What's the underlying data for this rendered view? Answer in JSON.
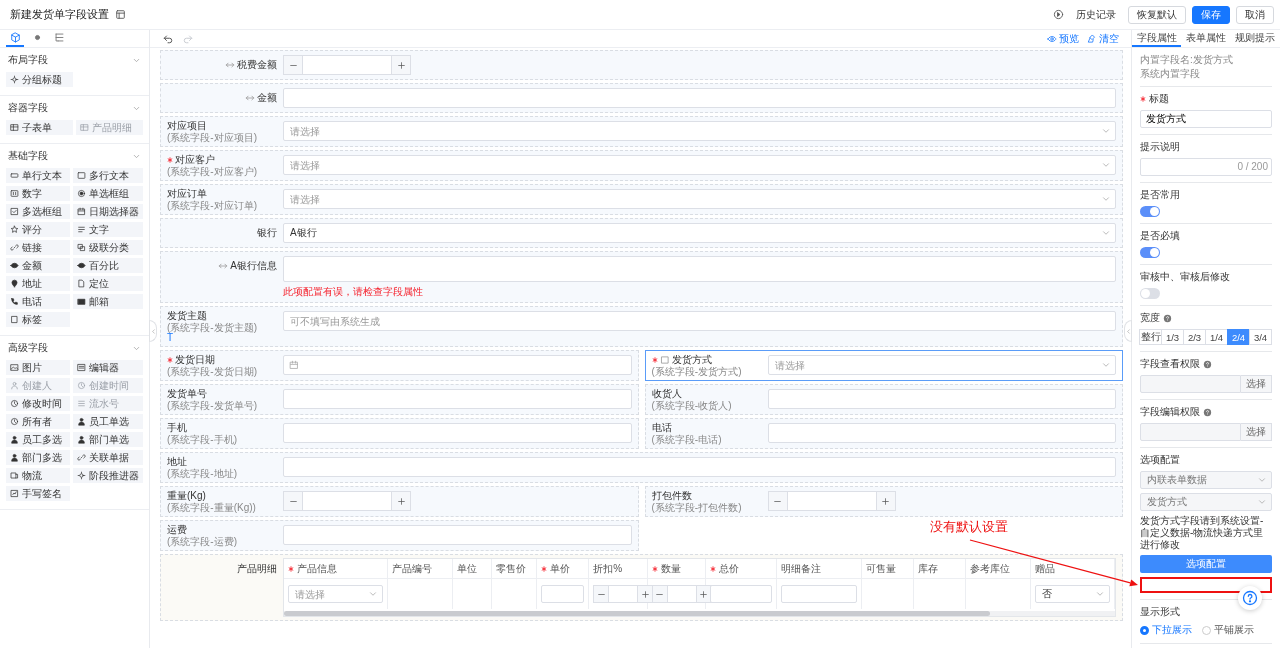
{
  "window": {
    "title": "新建发货单字段设置"
  },
  "header": {
    "history": "历史记录",
    "buttons": [
      {
        "label": "恢复默认",
        "kind": "default"
      },
      {
        "label": "保存",
        "kind": "primary"
      },
      {
        "label": "取消",
        "kind": "default"
      }
    ]
  },
  "sidebar": {
    "tabs": [
      {
        "kind": "components",
        "selected": true
      },
      {
        "kind": "settings",
        "selected": false
      },
      {
        "kind": "outline",
        "selected": false
      }
    ],
    "groups": [
      {
        "title": "布局字段",
        "expanded": true,
        "items": [
          {
            "label": "分组标题",
            "kind": "group-title",
            "disabled": false
          }
        ]
      },
      {
        "title": "容器字段",
        "expanded": true,
        "items": [
          {
            "label": "子表单",
            "kind": "subform",
            "disabled": false
          },
          {
            "label": "产品明细",
            "kind": "product",
            "disabled": true
          }
        ]
      },
      {
        "title": "基础字段",
        "expanded": true,
        "items": [
          {
            "label": "单行文本",
            "kind": "text-line",
            "disabled": false
          },
          {
            "label": "多行文本",
            "kind": "text-area",
            "disabled": false
          },
          {
            "label": "数字",
            "kind": "number",
            "disabled": false
          },
          {
            "label": "单选框组",
            "kind": "radio",
            "disabled": false
          },
          {
            "label": "多选框组",
            "kind": "checkbox",
            "disabled": false
          },
          {
            "label": "日期选择器",
            "kind": "date",
            "disabled": false
          },
          {
            "label": "评分",
            "kind": "rating",
            "disabled": false
          },
          {
            "label": "文字",
            "kind": "text",
            "disabled": false
          },
          {
            "label": "链接",
            "kind": "link",
            "disabled": false
          },
          {
            "label": "级联分类",
            "kind": "cascade",
            "disabled": false
          },
          {
            "label": "金额",
            "kind": "amount",
            "disabled": false
          },
          {
            "label": "百分比",
            "kind": "percent",
            "disabled": false
          },
          {
            "label": "地址",
            "kind": "address",
            "disabled": false
          },
          {
            "label": "定位",
            "kind": "location",
            "disabled": false
          },
          {
            "label": "电话",
            "kind": "phone",
            "disabled": false
          },
          {
            "label": "邮箱",
            "kind": "email",
            "disabled": false
          },
          {
            "label": "标签",
            "kind": "label",
            "disabled": false
          }
        ]
      },
      {
        "title": "高级字段",
        "expanded": true,
        "items": [
          {
            "label": "图片",
            "kind": "image",
            "disabled": false
          },
          {
            "label": "编辑器",
            "kind": "editor",
            "disabled": false
          },
          {
            "label": "创建人",
            "kind": "creator",
            "disabled": true
          },
          {
            "label": "创建时间",
            "kind": "created-time",
            "disabled": true
          },
          {
            "label": "修改时间",
            "kind": "modified-time",
            "disabled": false
          },
          {
            "label": "流水号",
            "kind": "serial",
            "disabled": true
          },
          {
            "label": "所有者",
            "kind": "owner",
            "disabled": false
          },
          {
            "label": "员工单选",
            "kind": "employee",
            "disabled": false
          },
          {
            "label": "员工多选",
            "kind": "employees",
            "disabled": false
          },
          {
            "label": "部门单选",
            "kind": "department",
            "disabled": false
          },
          {
            "label": "部门多选",
            "kind": "departments",
            "disabled": false
          },
          {
            "label": "关联单据",
            "kind": "relation",
            "disabled": false
          },
          {
            "label": "物流",
            "kind": "logistics",
            "disabled": false
          },
          {
            "label": "阶段推进器",
            "kind": "stage",
            "disabled": false
          },
          {
            "label": "手写签名",
            "kind": "signature",
            "disabled": false
          }
        ]
      }
    ]
  },
  "toolbar": {
    "undo_disabled": false,
    "redo_disabled": true,
    "links": [
      {
        "label": "预览",
        "kind": "preview"
      },
      {
        "label": "清空",
        "kind": "clear"
      }
    ]
  },
  "form": {
    "rows": [
      {
        "kind": "fields",
        "fields": [
          {
            "label": "税费金额",
            "linked": true,
            "boxed": false,
            "required": false,
            "kind": "stepper",
            "full_width": true,
            "selected": false
          }
        ]
      },
      {
        "kind": "fields",
        "fields": [
          {
            "label": "金额",
            "linked": true,
            "boxed": false,
            "required": false,
            "kind": "input",
            "full_width": true,
            "selected": false
          }
        ]
      },
      {
        "kind": "fields",
        "fields": [
          {
            "label": "对应项目",
            "sublabel": "(系统字段-对应项目)",
            "linked": false,
            "boxed": false,
            "required": false,
            "kind": "select",
            "placeholder": "请选择",
            "full_width": true,
            "selected": false
          }
        ]
      },
      {
        "kind": "fields",
        "fields": [
          {
            "label": "对应客户",
            "sublabel": "(系统字段-对应客户)",
            "linked": false,
            "boxed": false,
            "required": true,
            "kind": "select",
            "placeholder": "请选择",
            "full_width": true,
            "selected": false
          }
        ]
      },
      {
        "kind": "fields",
        "fields": [
          {
            "label": "对应订单",
            "sublabel": "(系统字段-对应订单)",
            "linked": false,
            "boxed": false,
            "required": false,
            "kind": "select",
            "placeholder": "请选择",
            "full_width": true,
            "selected": false
          }
        ]
      },
      {
        "kind": "fields",
        "fields": [
          {
            "label": "银行",
            "linked": false,
            "boxed": false,
            "required": false,
            "kind": "select",
            "value": "A银行",
            "full_width": true,
            "selected": false
          }
        ]
      },
      {
        "kind": "fields",
        "fields": [
          {
            "label": "A银行信息",
            "linked": true,
            "boxed": false,
            "required": false,
            "kind": "textarea",
            "error": "此项配置有误，请检查字段属性",
            "full_width": true,
            "selected": false
          }
        ]
      },
      {
        "kind": "fields",
        "fields": [
          {
            "label": "发货主题",
            "sublabel": "(系统字段-发货主题)",
            "type_mark": "T",
            "linked": false,
            "boxed": false,
            "required": false,
            "kind": "input",
            "placeholder": "可不填写由系统生成",
            "full_width": true,
            "selected": false
          }
        ]
      },
      {
        "kind": "fields",
        "fields": [
          {
            "label": "发货日期",
            "sublabel": "(系统字段-发货日期)",
            "linked": false,
            "boxed": false,
            "required": true,
            "kind": "date",
            "full_width": false,
            "selected": false
          },
          {
            "label": "发货方式",
            "sublabel": "(系统字段-发货方式)",
            "linked": false,
            "boxed": true,
            "required": true,
            "kind": "select",
            "placeholder": "请选择",
            "full_width": false,
            "selected": true
          }
        ]
      },
      {
        "kind": "fields",
        "fields": [
          {
            "label": "发货单号",
            "sublabel": "(系统字段-发货单号)",
            "linked": false,
            "boxed": false,
            "required": false,
            "kind": "input",
            "full_width": false,
            "selected": false
          },
          {
            "label": "收货人",
            "sublabel": "(系统字段-收货人)",
            "linked": false,
            "boxed": false,
            "required": false,
            "kind": "input",
            "full_width": false,
            "selected": false
          }
        ]
      },
      {
        "kind": "fields",
        "fields": [
          {
            "label": "手机",
            "sublabel": "(系统字段-手机)",
            "linked": false,
            "boxed": false,
            "required": false,
            "kind": "input",
            "full_width": false,
            "selected": false
          },
          {
            "label": "电话",
            "sublabel": "(系统字段-电话)",
            "linked": false,
            "boxed": false,
            "required": false,
            "kind": "input",
            "full_width": false,
            "selected": false
          }
        ]
      },
      {
        "kind": "fields",
        "fields": [
          {
            "label": "地址",
            "sublabel": "(系统字段-地址)",
            "linked": false,
            "boxed": false,
            "required": false,
            "kind": "input",
            "full_width": true,
            "selected": false
          }
        ]
      },
      {
        "kind": "fields",
        "fields": [
          {
            "label": "重量(Kg)",
            "sublabel": "(系统字段-重量(Kg))",
            "linked": false,
            "boxed": false,
            "required": false,
            "kind": "stepper",
            "full_width": false,
            "selected": false
          },
          {
            "label": "打包件数",
            "sublabel": "(系统字段-打包件数)",
            "linked": false,
            "boxed": false,
            "required": false,
            "kind": "stepper",
            "full_width": false,
            "selected": false
          }
        ]
      },
      {
        "kind": "fields",
        "fields": [
          {
            "label": "运费",
            "sublabel": "(系统字段-运费)",
            "linked": false,
            "boxed": false,
            "required": false,
            "kind": "input",
            "full_width": false,
            "selected": false
          }
        ]
      },
      {
        "kind": "table",
        "label": "产品明细",
        "columns": [
          {
            "label": "产品信息",
            "required": true
          },
          {
            "label": "产品编号",
            "required": false
          },
          {
            "label": "单位",
            "required": false
          },
          {
            "label": "零售价",
            "required": false
          },
          {
            "label": "单价",
            "required": true
          },
          {
            "label": "折扣%",
            "required": false
          },
          {
            "label": "数量",
            "required": true
          },
          {
            "label": "总价",
            "required": true
          },
          {
            "label": "明细备注",
            "required": false
          },
          {
            "label": "可售量",
            "required": false
          },
          {
            "label": "库存",
            "required": false
          },
          {
            "label": "参考库位",
            "required": false
          },
          {
            "label": "赠品",
            "required": false
          }
        ],
        "cells": [
          {
            "kind": "select",
            "placeholder": "请选择"
          },
          {
            "kind": "empty"
          },
          {
            "kind": "empty"
          },
          {
            "kind": "empty"
          },
          {
            "kind": "input"
          },
          {
            "kind": "stepper"
          },
          {
            "kind": "stepper"
          },
          {
            "kind": "input"
          },
          {
            "kind": "input"
          },
          {
            "kind": "empty"
          },
          {
            "kind": "empty"
          },
          {
            "kind": "empty"
          },
          {
            "kind": "select",
            "value": "否"
          }
        ]
      }
    ]
  },
  "properties": {
    "tabs": [
      {
        "label": "字段属性",
        "selected": true
      },
      {
        "label": "表单属性",
        "selected": false
      },
      {
        "label": "规则提示",
        "selected": false
      }
    ],
    "field_name": "内置字段名:发货方式",
    "field_type": "系统内置字段",
    "sections": [
      {
        "kind": "input",
        "label": "标题",
        "required": true,
        "help": false,
        "value": "发货方式"
      },
      {
        "kind": "counter",
        "label": "提示说明",
        "required": false,
        "help": false,
        "counter": "0 / 200"
      },
      {
        "kind": "switch",
        "label": "是否常用",
        "required": false,
        "help": false,
        "on": true
      },
      {
        "kind": "switch",
        "label": "是否必填",
        "required": false,
        "help": false,
        "on": true
      },
      {
        "kind": "switch",
        "label": "审核中、审核后修改",
        "required": false,
        "help": false,
        "on": false
      },
      {
        "kind": "segments",
        "label": "宽度",
        "required": false,
        "help": true,
        "options": [
          {
            "label": "整行",
            "selected": false
          },
          {
            "label": "1/3",
            "selected": false
          },
          {
            "label": "2/3",
            "selected": false
          },
          {
            "label": "1/4",
            "selected": false
          },
          {
            "label": "2/4",
            "selected": true
          },
          {
            "label": "3/4",
            "selected": false
          }
        ]
      },
      {
        "kind": "picker",
        "label": "字段查看权限",
        "required": false,
        "help": true,
        "button": "选择"
      },
      {
        "kind": "picker",
        "label": "字段编辑权限",
        "required": false,
        "help": true,
        "button": "选择"
      },
      {
        "kind": "options",
        "label": "选项配置",
        "required": false,
        "help": false,
        "selects": [
          {
            "value": "内联表单数据",
            "disabled": true
          },
          {
            "value": "发货方式",
            "disabled": true
          }
        ],
        "note": "发货方式字段请到系统设置-自定义数据-物流快递方式里进行修改",
        "button": "选项配置",
        "highlighted": true
      },
      {
        "kind": "radios",
        "label": "显示形式",
        "required": false,
        "help": false,
        "options": [
          {
            "label": "下拉展示",
            "selected": true
          },
          {
            "label": "平铺展示",
            "selected": false
          }
        ]
      }
    ]
  },
  "annotation": {
    "text": "没有默认设置"
  }
}
